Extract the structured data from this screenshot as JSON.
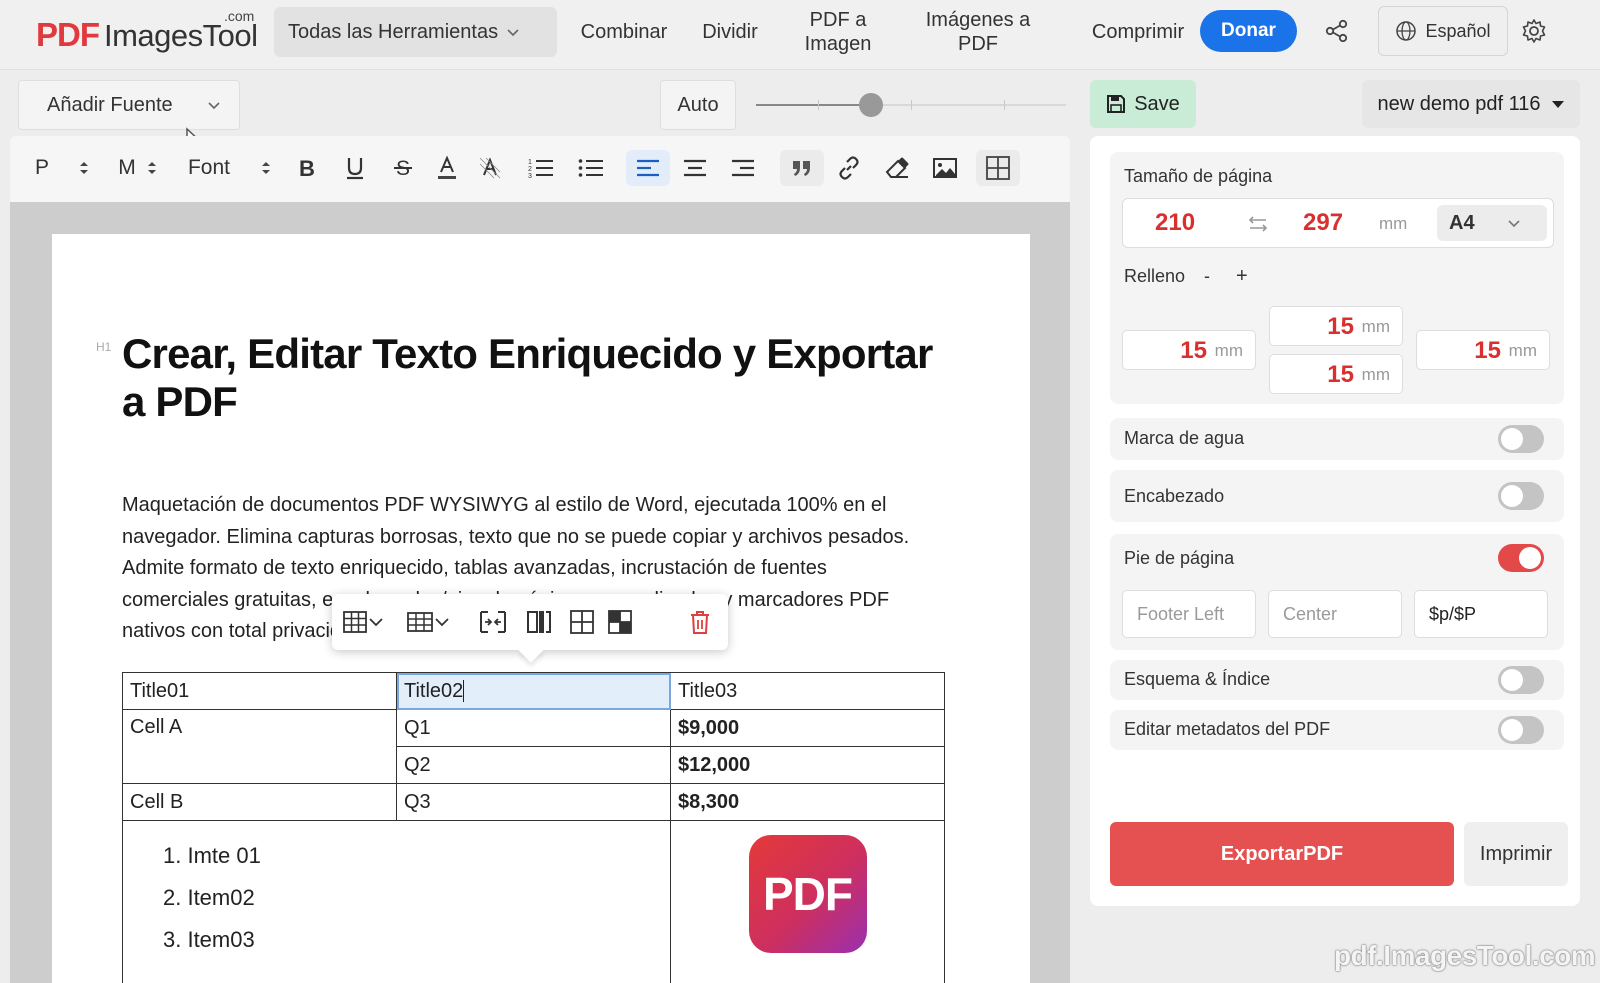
{
  "logo": {
    "brand_bold": "PDF",
    "brand_rest": "ImagesTool",
    "brand_suffix": ".com"
  },
  "header": {
    "all_tools": "Todas las Herramientas",
    "nav": [
      {
        "label": "Combinar"
      },
      {
        "label": "Dividir"
      },
      {
        "label": "PDF a Imagen"
      },
      {
        "label": "Imágenes a PDF"
      },
      {
        "label": "Comprimir"
      }
    ],
    "donate": "Donar",
    "language": "Español"
  },
  "editor": {
    "add_font": "Añadir Fuente",
    "auto": "Auto",
    "zoom_fraction": 0.37,
    "toolbar": {
      "paragraph": "P",
      "size": "M",
      "font": "Font"
    }
  },
  "document": {
    "h1_tag": "H1",
    "title": "Crear, Editar Texto Enriquecido y Exportar a PDF",
    "paragraph": "Maquetación de documentos PDF WYSIWYG al estilo de Word, ejecutada 100% en el navegador. Elimina capturas borrosas, texto que no se puede copiar y archivos pesados. Admite formato de texto enriquecido, tablas avanzadas, incrustación de fuentes comerciales gratuitas, encabezados/pies de página personalizados y marcadores PDF nativos con total privacidad.",
    "table": {
      "headers": [
        "Title01",
        "Title02",
        "Title03"
      ],
      "cell_a": "Cell A",
      "cell_b": "Cell B",
      "rows": [
        {
          "q": "Q1",
          "amount": "$9,000"
        },
        {
          "q": "Q2",
          "amount": "$12,000"
        },
        {
          "q": "Q3",
          "amount": "$8,300"
        }
      ],
      "list": [
        "1. Imte 01",
        "2. Item02",
        "3. Item03"
      ],
      "image_label": "PDF"
    }
  },
  "panel": {
    "save": "Save",
    "doc_name": "new demo pdf 116",
    "page_size_label": "Tamaño de página",
    "width": "210",
    "height": "297",
    "unit": "mm",
    "format": "A4",
    "padding_label": "Relleno",
    "padding_minus": "-",
    "padding_plus": "+",
    "padding": {
      "top": "15",
      "left": "15",
      "right": "15",
      "bottom": "15"
    },
    "watermark_label": "Marca de agua",
    "watermark_on": false,
    "header_label": "Encabezado",
    "header_on": false,
    "footer_label": "Pie de página",
    "footer_on": true,
    "footer": {
      "left_placeholder": "Footer Left",
      "center_placeholder": "Center",
      "right_value": "$p/$P"
    },
    "outline_label": "Esquema & Índice",
    "outline_on": false,
    "metadata_label": "Editar metadatos del PDF",
    "metadata_on": false,
    "export": "ExportarPDF",
    "print": "Imprimir"
  },
  "watermark_text": "pdf.ImagesTool.com",
  "colors": {
    "accent_blue": "#1a73e8",
    "brand_red": "#e03a3e",
    "export_red": "#e55151",
    "save_green": "#c9ecd6"
  }
}
